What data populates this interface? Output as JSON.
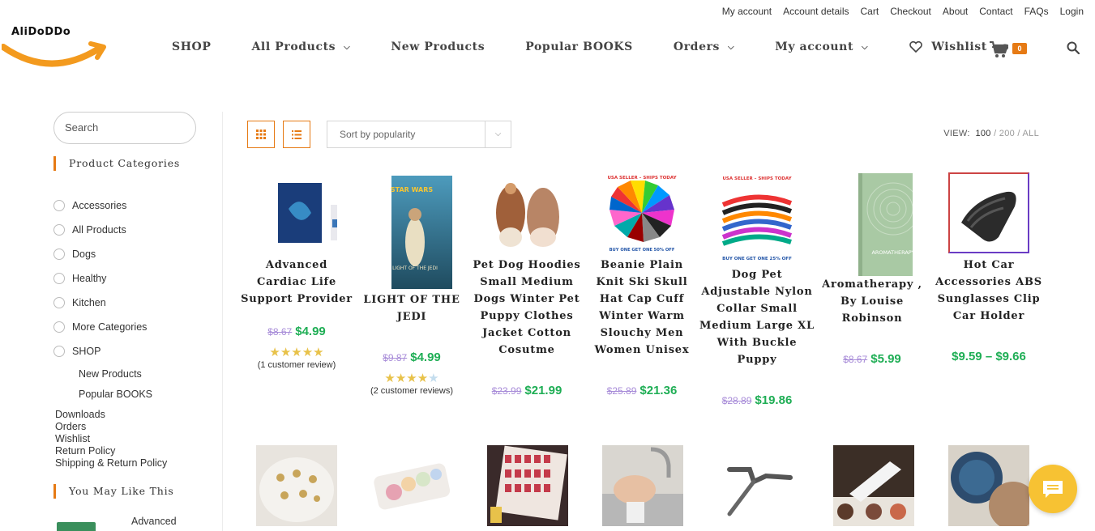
{
  "topbar": {
    "links": [
      "My account",
      "Account details",
      "Cart",
      "Checkout",
      "About",
      "Contact",
      "FAQs",
      "Login"
    ]
  },
  "logo": {
    "text": "AliDoDDo"
  },
  "nav": {
    "shop": "SHOP",
    "all_products": "All Products",
    "new_products": "New Products",
    "popular_books": "Popular BOOKS",
    "orders": "Orders",
    "my_account": "My account",
    "wishlist": "Wishlist - o",
    "cart_count": "0"
  },
  "sidebar": {
    "search_placeholder": "Search",
    "categories_title": "Product Categories",
    "categories": [
      "Accessories",
      "All Products",
      "Dogs",
      "Healthy",
      "Kitchen",
      "More Categories",
      "SHOP"
    ],
    "shop_sub": [
      "New Products",
      "Popular BOOKS"
    ],
    "pages": [
      "Downloads",
      "Orders",
      "Wishlist",
      "Return Policy",
      "Shipping & Return Policy"
    ],
    "you_may_like_title": "You May Like This",
    "you_may_like_item": "Advanced"
  },
  "toolbar": {
    "sort": "Sort by popularity",
    "view_label": "VIEW:",
    "view_100": "100",
    "view_200": "200",
    "view_all": "ALL",
    "sep": "/"
  },
  "products": [
    {
      "title": "Advanced Cardiac Life Support Provider",
      "old_price": "$8.67",
      "price": "$4.99",
      "rating": 5,
      "reviews": "(1 customer review)"
    },
    {
      "title": "LIGHT OF THE JEDI",
      "old_price": "$9.87",
      "price": "$4.99",
      "rating": 4,
      "reviews": "(2 customer reviews)"
    },
    {
      "title": "Pet Dog Hoodies Small Medium Dogs Winter Pet Puppy Clothes Jacket Cotton Cosutme",
      "old_price": "$23.99",
      "price": "$21.99"
    },
    {
      "title": "Beanie Plain Knit Ski Skull Hat Cap Cuff Winter Warm Slouchy Men Women Unisex",
      "old_price": "$25.89",
      "price": "$21.36"
    },
    {
      "title": "Dog Pet Adjustable Nylon Collar Small Medium Large XL With Buckle Puppy",
      "old_price": "$28.89",
      "price": "$19.86"
    },
    {
      "title": "Aromatherapy , By Louise Robinson",
      "old_price": "$8.67",
      "price": "$5.99"
    },
    {
      "title": "Hot Car Accessories ABS Sunglasses Clip Car Holder",
      "price": "$9.59 – $9.66"
    }
  ],
  "image_text": {
    "ships_today": "USA SELLER – SHIPS TODAY",
    "beanie_offer": "BUY ONE GET ONE 50% OFF",
    "collar_offer": "BUY ONE GET ONE 25% OFF",
    "aroma_book": "AROMATHERAPY",
    "jedi_brand": "STAR WARS",
    "jedi_cover": "LIGHT OF THE JEDI"
  },
  "colors": {
    "accent": "#e67a14",
    "sale_price": "#1fae55",
    "old_price": "#a78bd8",
    "chat": "#f7c233"
  }
}
